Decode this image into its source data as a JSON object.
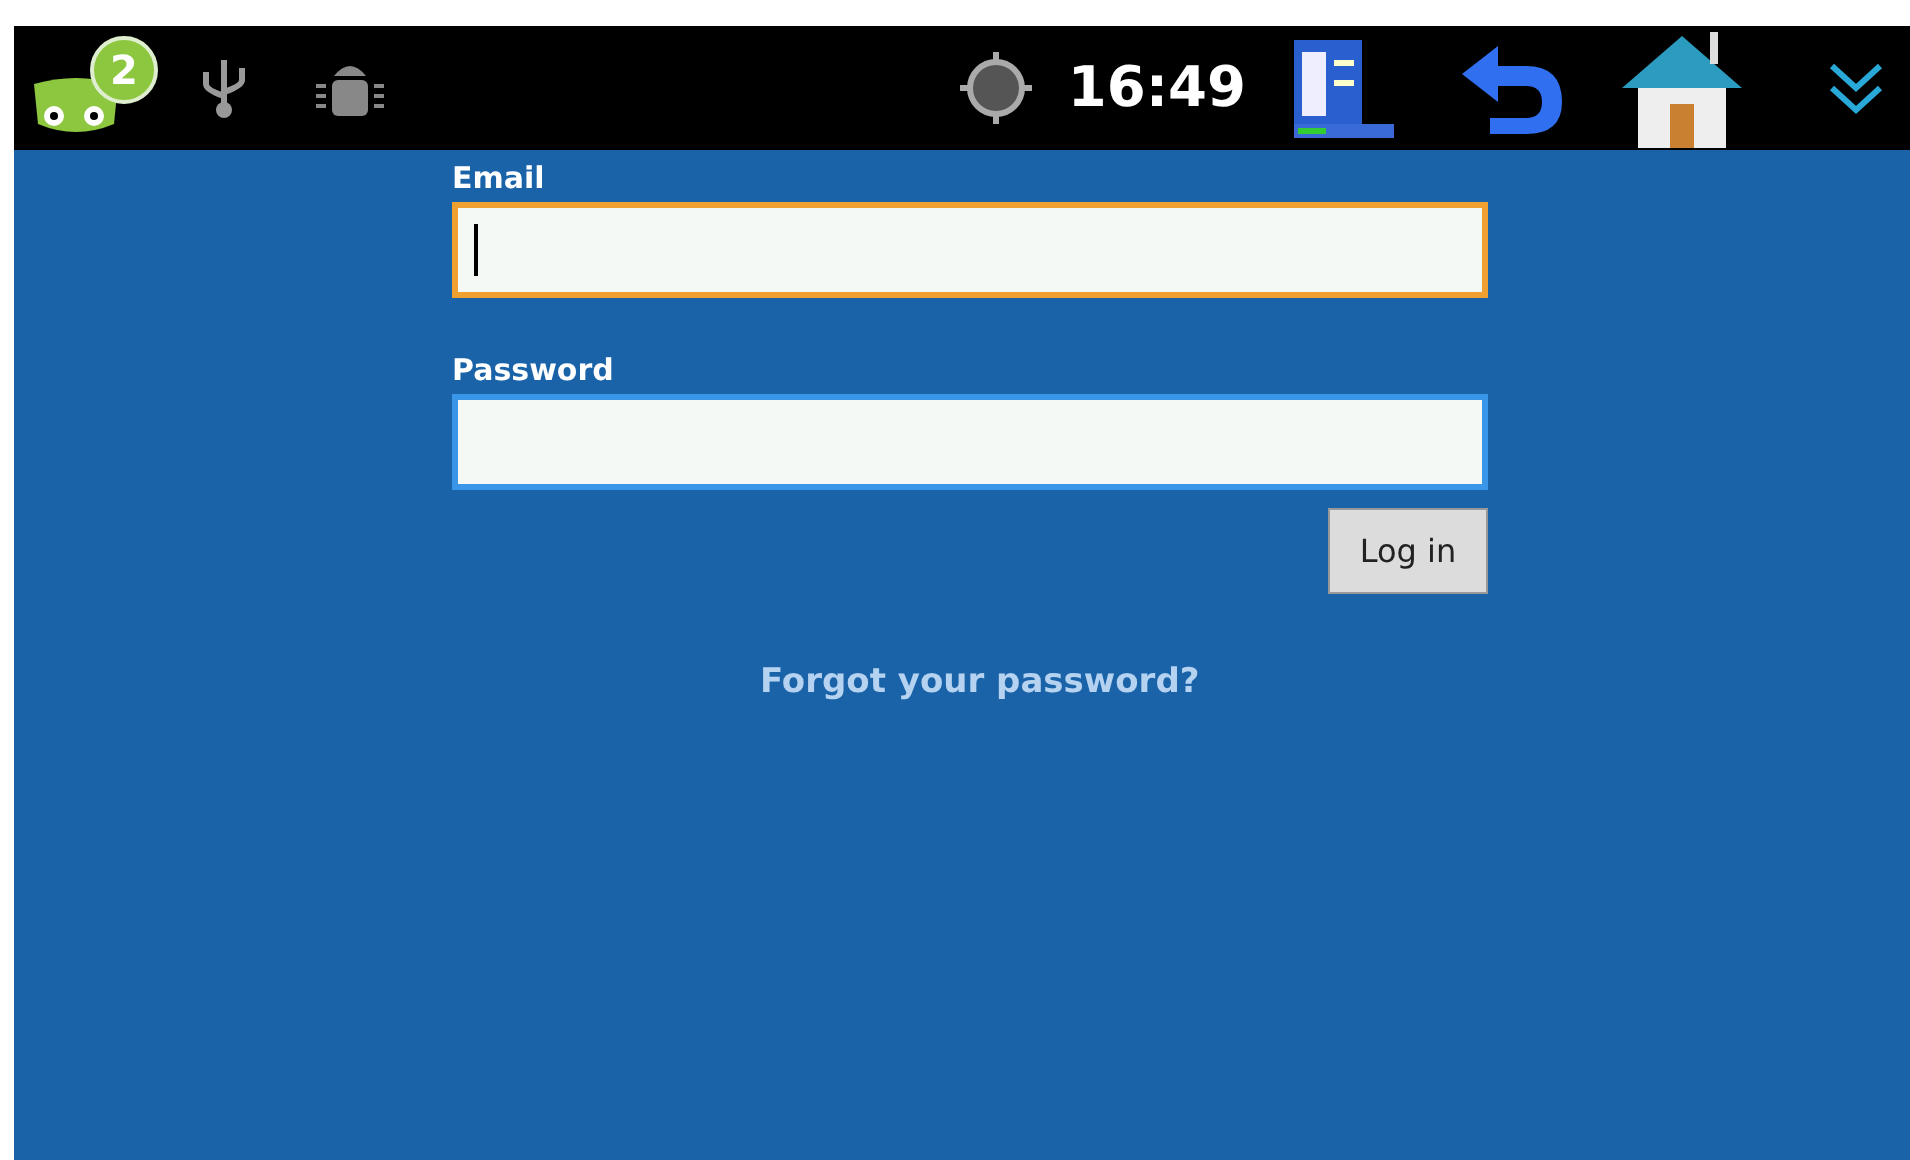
{
  "status_bar": {
    "notification_count": "2",
    "time": "16:49"
  },
  "form": {
    "email": {
      "label": "Email",
      "focused": true
    },
    "password": {
      "label": "Password",
      "focused": false
    },
    "login_button": "Log in",
    "forgot_link": "Forgot your password?"
  }
}
